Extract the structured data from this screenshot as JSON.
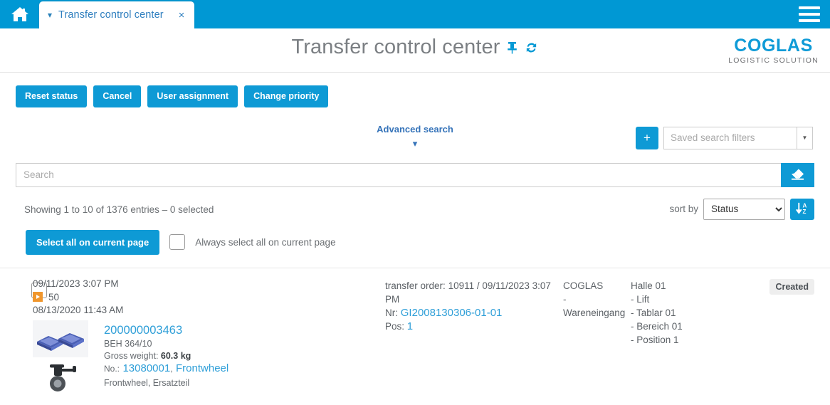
{
  "topbar": {
    "home_icon": "home-icon",
    "tab": {
      "caret_icon": "chevron-down-icon",
      "label": "Transfer control center",
      "close_icon": "close-icon",
      "close_glyph": "×"
    },
    "menu_icon": "hamburger-menu-icon",
    "bg_color": "#0098d4"
  },
  "header": {
    "title": "Transfer control center",
    "pin_icon": "pin-icon",
    "refresh_icon": "refresh-icon",
    "logo_main": "COGLAS",
    "logo_sub": "LOGISTIC SOLUTION",
    "logo_color": "#0f9bd7"
  },
  "toolbar": {
    "buttons": [
      {
        "label": "Reset status"
      },
      {
        "label": "Cancel"
      },
      {
        "label": "User assignment"
      },
      {
        "label": "Change priority"
      }
    ],
    "accent_color": "#0e9ad5"
  },
  "search": {
    "advanced_label": "Advanced search",
    "advanced_caret": "▾",
    "add_filter_label": "+",
    "saved_filters_placeholder": "Saved search filters",
    "saved_filters_value": "",
    "dropdown_arrow": "▼",
    "input_placeholder": "Search",
    "input_value": "",
    "eraser_icon": "eraser-icon"
  },
  "info": {
    "showing": "Showing 1 to 10 of 1376 entries  –  0 selected",
    "sort_label": "sort by",
    "sort_value": "Status",
    "sort_options": [
      "Status"
    ],
    "sort_direction_icon": "sort-ascending-icon"
  },
  "selection": {
    "select_all_label": "Select all on current page",
    "always_select_label": "Always select all on current page",
    "always_select_checked": false
  },
  "rows": [
    {
      "selected": false,
      "date_created": "09/11/2023 3:07 PM",
      "priority_icon": "priority-arrow-icon",
      "priority": "50",
      "date_secondary": "08/13/2020 11:43 AM",
      "thumb1_name": "blue-bin-thumbnail",
      "thumb2_name": "frontwheel-thumbnail",
      "item_id": "200000003463",
      "item_container": "BEH 364/10",
      "gross_weight_label": "Gross weight:",
      "gross_weight_value": "60.3 kg",
      "article_no_label": "No.:",
      "article_no": "13080001",
      "article_sep": ",",
      "article_name": "Frontwheel",
      "article_desc": "Frontwheel, Ersatzteil",
      "order_label": "transfer order:",
      "order_value": "10911 / 09/11/2023 3:07 PM",
      "nr_label": "Nr:",
      "nr_value": "GI2008130306-01-01",
      "pos_label": "Pos:",
      "pos_value": "1",
      "client_line1": "COGLAS",
      "client_line2": "-",
      "client_line3": "Wareneingang",
      "location": [
        "Halle 01",
        "- Lift",
        "- Tablar 01",
        "- Bereich 01",
        "- Position 1"
      ],
      "status": "Created"
    }
  ]
}
